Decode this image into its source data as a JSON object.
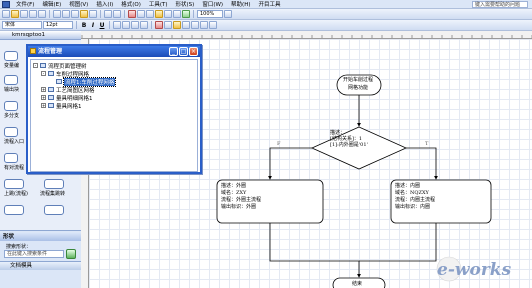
{
  "menubar": {
    "items": [
      "文件(F)",
      "编辑(E)",
      "视图(V)",
      "插入(I)",
      "格式(O)",
      "工具(T)",
      "形状(S)",
      "窗口(W)",
      "帮助(H)",
      "开目工具"
    ],
    "help_placeholder": "键入需要帮助的问题"
  },
  "toolbar": {
    "zoom": "100%",
    "font_name": "宋体",
    "font_size": "12pt"
  },
  "shapes_panel": {
    "title": "形状",
    "stencil_tab": "kmrsqptoo1",
    "shapes": [
      "变量编",
      "输出块",
      "多分支",
      "流程入口",
      "有对流程",
      "上跳(流程)",
      "流程集跳转"
    ],
    "search_title": "形状",
    "search_label": "搜索形状：",
    "search_placeholder": "在此键入搜索条件",
    "doc_stencil": "文档模具"
  },
  "dialog": {
    "title": "流程管理",
    "tree": [
      {
        "label": "流程页面管理树",
        "level": 0,
        "toggle": "-"
      },
      {
        "label": "车削过程网格",
        "level": 1,
        "toggle": "-"
      },
      {
        "label": "流程1:车削过程网格",
        "level": 2,
        "toggle": "",
        "selected": true
      },
      {
        "label": "工艺简图区网格",
        "level": 1,
        "toggle": "+"
      },
      {
        "label": "量具明细网格1",
        "level": 1,
        "toggle": "+"
      },
      {
        "label": "量具网格1",
        "level": 1,
        "toggle": "+"
      }
    ]
  },
  "flowchart": {
    "start": [
      "开始车削过程",
      "网格功能"
    ],
    "decision": [
      "描述：",
      "[结构关系]：1",
      "[1]:内外圈是'01'"
    ],
    "branch_false": "F",
    "branch_true": "T",
    "left_box": [
      "描述：外圈",
      "域名：ZXY",
      "流程：外圈主流程",
      "输出标识：外圈"
    ],
    "right_box": [
      "描述：内圈",
      "域名：NQZXY",
      "流程：内圈主流程",
      "输出标识：内圈"
    ],
    "end": "结束"
  },
  "watermark": {
    "text": "e-works"
  }
}
